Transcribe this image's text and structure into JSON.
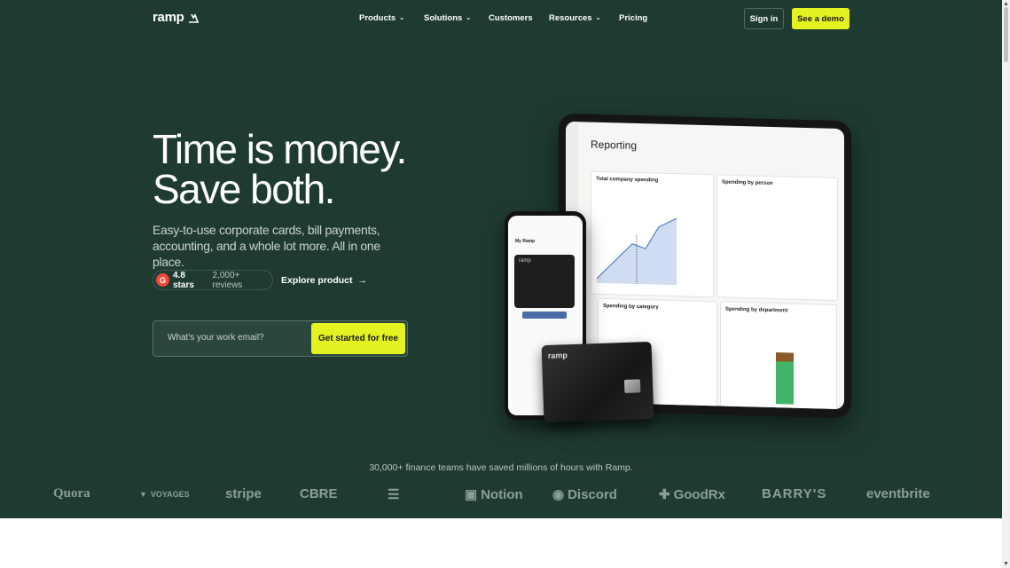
{
  "brand": {
    "logo_text": "ramp"
  },
  "nav": {
    "items": [
      {
        "label": "Products",
        "has_dropdown": true
      },
      {
        "label": "Solutions",
        "has_dropdown": true
      },
      {
        "label": "Customers",
        "has_dropdown": false
      },
      {
        "label": "Resources",
        "has_dropdown": true
      },
      {
        "label": "Pricing",
        "has_dropdown": false
      }
    ],
    "sign_in": "Sign in",
    "demo": "See a demo"
  },
  "hero": {
    "headline_line1": "Time is money.",
    "headline_line2": "Save both.",
    "sub_line1": "Easy-to-use corporate cards, bill payments,",
    "sub_line2": "accounting, and a whole lot more. All in one place.",
    "rating_badge": "G",
    "rating_stars": "4.8 stars",
    "rating_reviews": "2,000+ reviews",
    "explore": "Explore product",
    "email_placeholder": "What's your work email?",
    "cta": "Get started for free"
  },
  "product_shot": {
    "tablet_title": "Reporting",
    "card1": "Total company spending",
    "card2": "Spending by person",
    "card3": "Spending by category",
    "card4": "Spending by department",
    "phone_title": "My Ramp",
    "card_logo": "ramp"
  },
  "social_proof": {
    "tagline": "30,000+ finance teams have saved millions of hours with Ramp.",
    "logos": [
      "Quora",
      "VOYAGES",
      "stripe",
      "CBRE",
      "Notion",
      "Discord",
      "GoodRx",
      "BARRY'S",
      "eventbrite"
    ]
  },
  "colors": {
    "bg": "#1f3b31",
    "accent": "#e4f221"
  }
}
